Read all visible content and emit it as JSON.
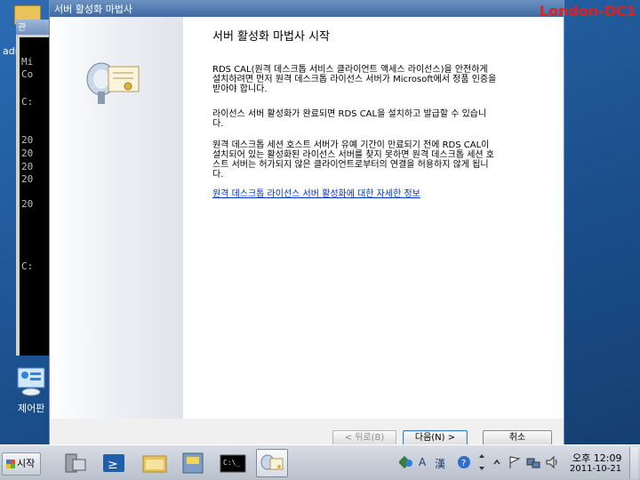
{
  "desktop": {
    "left_label": "adr",
    "control_panel_label": "제어판"
  },
  "console": {
    "title": "관",
    "lines": [
      "Mi",
      "Co",
      "C:",
      "",
      "20",
      "20",
      "20",
      "20",
      "",
      "20",
      "C:"
    ]
  },
  "wizard": {
    "window_title": "서버 활성화 마법사",
    "page_title": "서버 활성화 마법사 시작",
    "para1": "RDS CAL(원격 데스크톱 서비스 클라이언트 액세스 라이선스)을 안전하게 설치하려면 먼저 원격 데스크톱 라이선스 서버가 Microsoft에서 정품 인증을 받아야 합니다.",
    "para2": "라이선스 서버 활성화가 완료되면 RDS CAL을 설치하고 발급할 수 있습니다.",
    "para3": "원격 데스크톱 세션 호스트 서버가 유예 기간이 만료되기 전에 RDS CAL이 설치되어 있는 활성화된 라이선스 서버를 찾지 못하면 원격 데스크톱 세션 호스트 서버는 허가되지 않은 클라이언트로부터의 연결을 허용하지 않게 됩니다.",
    "link": "원격 데스크톱 라이선스 서버 활성화에 대한 자세한 정보",
    "buttons": {
      "back": "< 뒤로(B)",
      "next": "다음(N) >",
      "cancel": "취소"
    }
  },
  "watermark": "London-DC1",
  "taskbar": {
    "start_label": "시작",
    "ime_glyphs": [
      "A",
      "漢"
    ],
    "clock_time": "오후 12:09",
    "clock_date": "2011-10-21"
  },
  "colors": {
    "accent": "#3e6aa3",
    "link": "#0033cc",
    "watermark": "#e02020"
  }
}
